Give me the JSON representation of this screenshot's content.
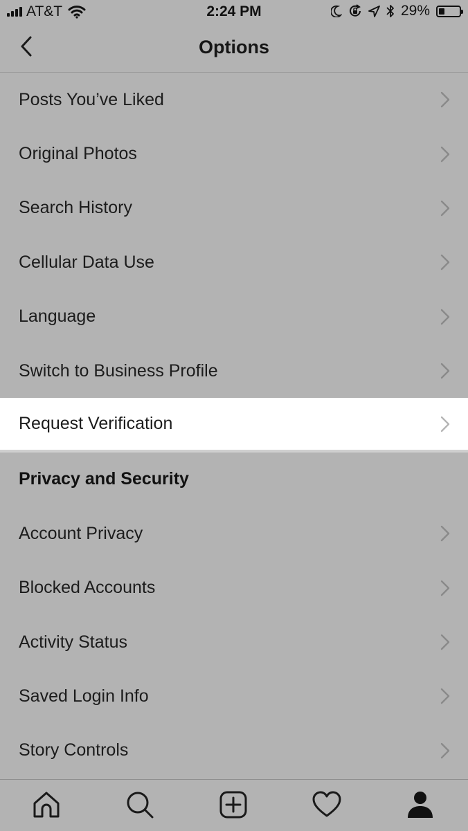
{
  "status_bar": {
    "carrier": "AT&T",
    "time": "2:24 PM",
    "battery_percent_text": "29%",
    "battery_level": 0.29,
    "icons": [
      "signal-icon",
      "wifi-icon",
      "moon-icon",
      "rotation-lock-icon",
      "location-icon",
      "bluetooth-icon",
      "battery-icon"
    ]
  },
  "nav": {
    "title": "Options",
    "back_icon": "chevron-left-icon"
  },
  "menu": {
    "items": [
      {
        "label": "Posts You’ve Liked"
      },
      {
        "label": "Original Photos"
      },
      {
        "label": "Search History"
      },
      {
        "label": "Cellular Data Use"
      },
      {
        "label": "Language"
      },
      {
        "label": "Switch to Business Profile"
      },
      {
        "label": "Request Verification",
        "highlighted": true
      }
    ],
    "section_header": "Privacy and Security",
    "privacy_items": [
      {
        "label": "Account Privacy"
      },
      {
        "label": "Blocked Accounts"
      },
      {
        "label": "Activity Status"
      },
      {
        "label": "Saved Login Info"
      },
      {
        "label": "Story Controls"
      }
    ]
  },
  "tab_bar": {
    "tabs": [
      "home-icon",
      "search-icon",
      "add-post-icon",
      "heart-icon",
      "profile-icon"
    ],
    "active": "profile-icon"
  },
  "colors": {
    "dimmed_background": "#b3b3b3",
    "highlight_background": "#ffffff",
    "chevron": "#8a8a8a",
    "text": "#1c1c1c"
  }
}
